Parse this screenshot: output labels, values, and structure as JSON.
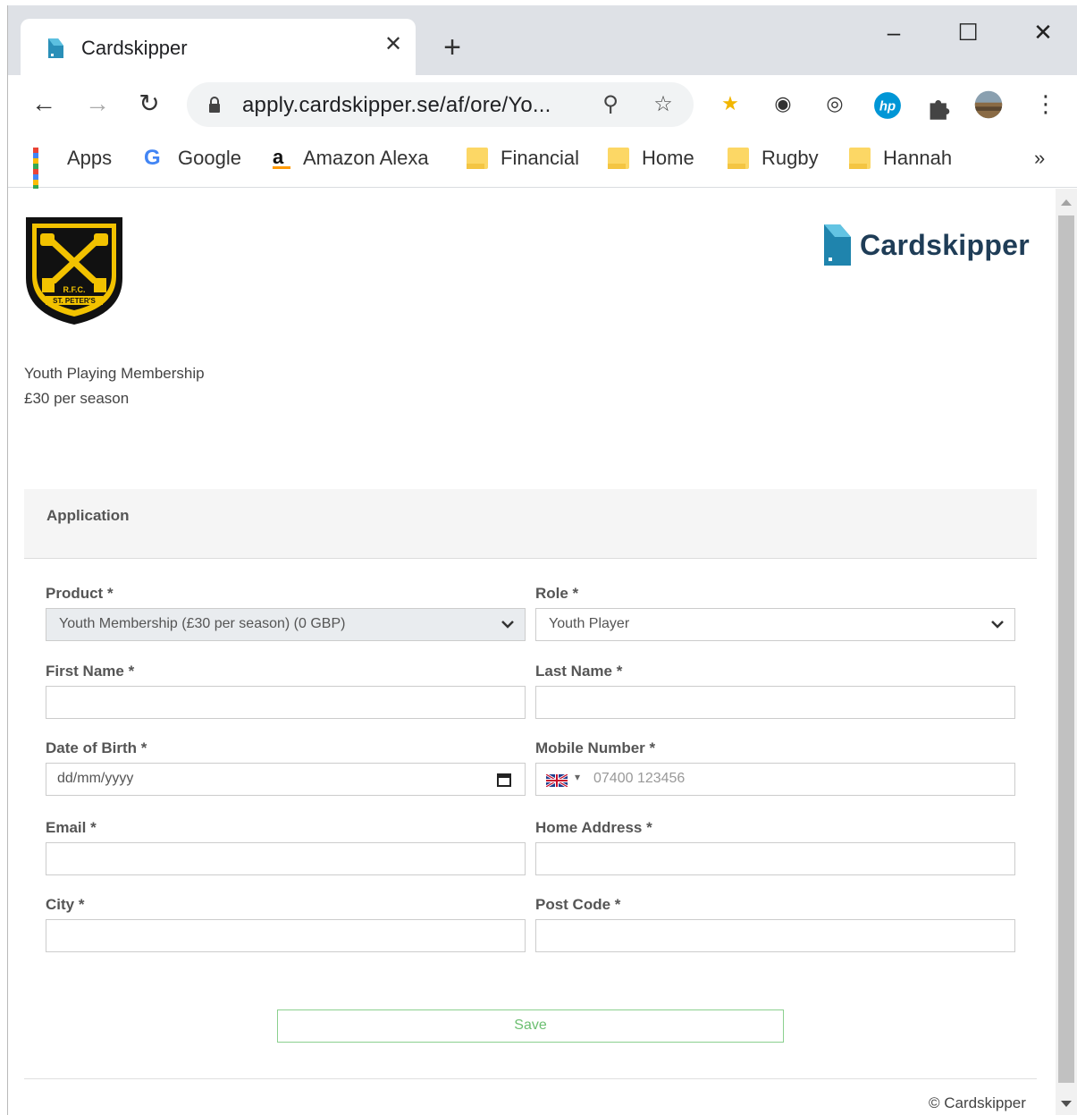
{
  "browser": {
    "tab_title": "Cardskipper",
    "url": "apply.cardskipper.se/af/ore/Yo...",
    "window_controls": {
      "minimize": "–",
      "maximize": "☐",
      "close": "✕"
    },
    "bookmarks": [
      {
        "label": "Apps",
        "icon": "apps-grid-icon"
      },
      {
        "label": "Google",
        "icon": "google-icon"
      },
      {
        "label": "Amazon Alexa",
        "icon": "amazon-icon"
      },
      {
        "label": "Financial",
        "icon": "folder-icon"
      },
      {
        "label": "Home",
        "icon": "folder-icon"
      },
      {
        "label": "Rugby",
        "icon": "folder-icon"
      },
      {
        "label": "Hannah",
        "icon": "folder-icon"
      }
    ],
    "bookmarks_overflow": "»"
  },
  "page": {
    "brand": "Cardskipper",
    "membership": {
      "title": "Youth Playing Membership",
      "price": "£30 per season"
    },
    "form": {
      "section_title": "Application",
      "product": {
        "label": "Product *",
        "value": "Youth Membership (£30 per season) (0 GBP)"
      },
      "role": {
        "label": "Role *",
        "value": "Youth Player"
      },
      "first_name": {
        "label": "First Name *",
        "value": ""
      },
      "last_name": {
        "label": "Last Name *",
        "value": ""
      },
      "dob": {
        "label": "Date of Birth *",
        "placeholder": "dd/mm/yyyy"
      },
      "mobile": {
        "label": "Mobile Number *",
        "placeholder": "07400 123456"
      },
      "email": {
        "label": "Email *",
        "value": ""
      },
      "address": {
        "label": "Home Address *",
        "value": ""
      },
      "city": {
        "label": "City *",
        "value": ""
      },
      "post_code": {
        "label": "Post Code *",
        "value": ""
      },
      "save_label": "Save"
    },
    "footer": "© Cardskipper"
  },
  "colors": {
    "brand_text": "#1f3d57",
    "save_border": "#8bd08f",
    "save_text": "#6cbf71",
    "panel_bg": "#f5f5f5"
  }
}
